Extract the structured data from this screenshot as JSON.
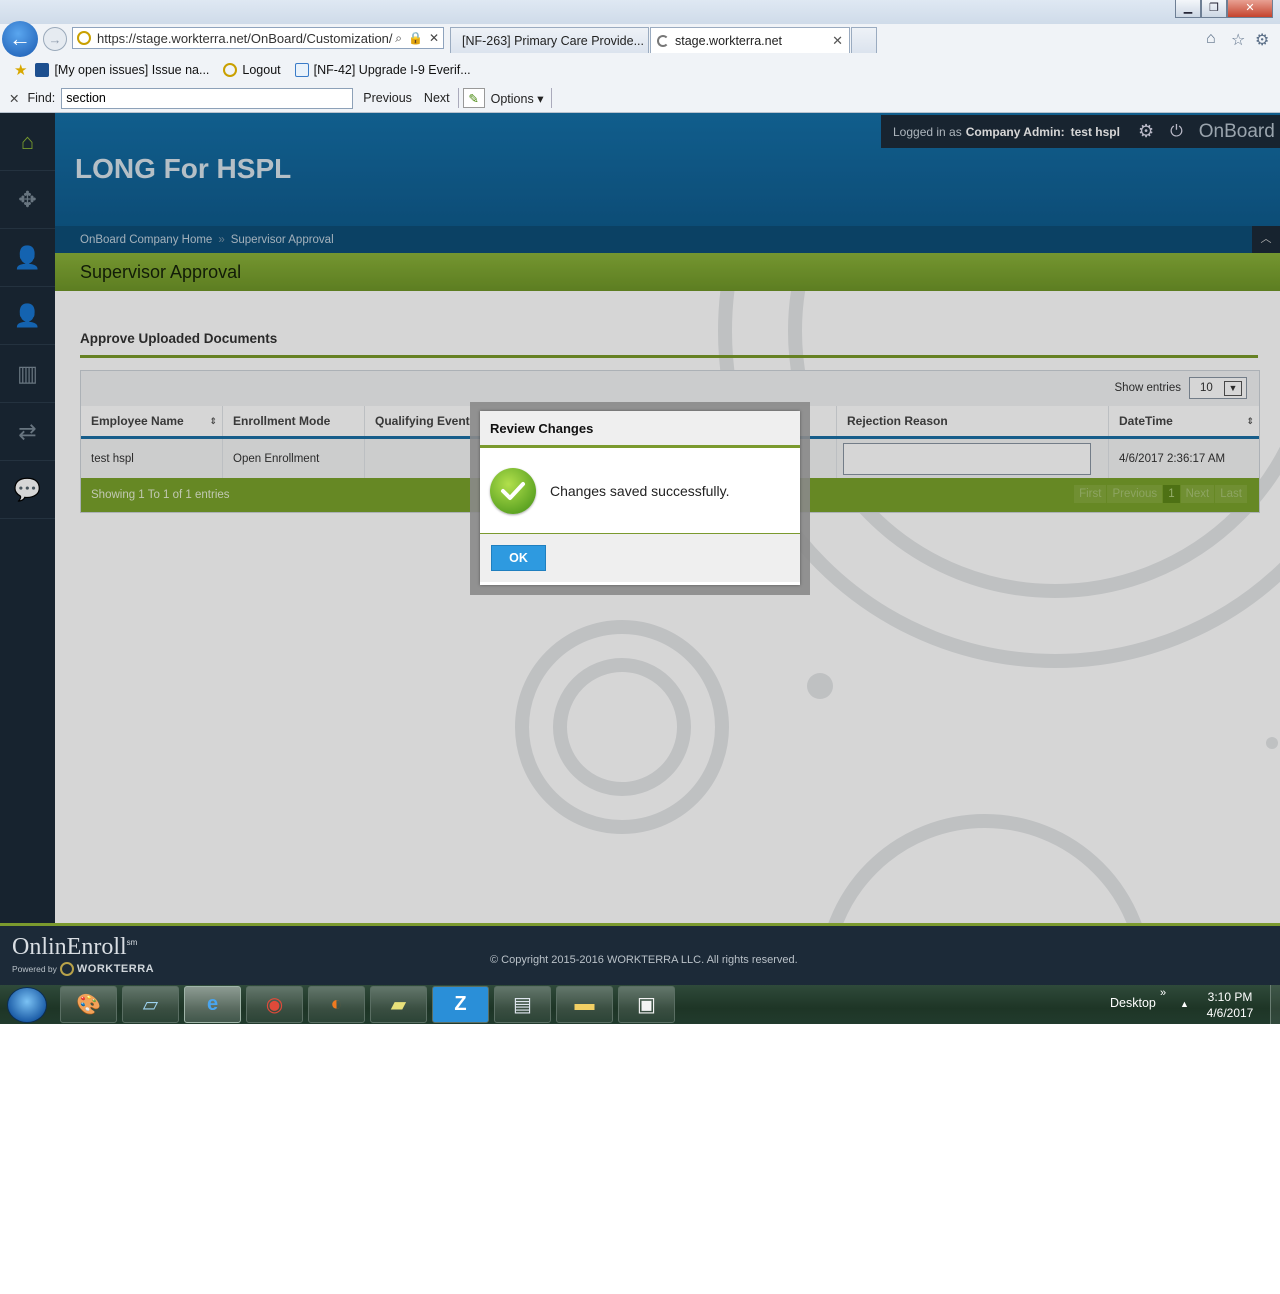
{
  "browser": {
    "address": "https://stage.workterra.net/OnBoard/Customization/",
    "address_host": "https://stage.workterra.net",
    "address_path": "/OnBoard/Customization/",
    "tabs": [
      {
        "label": "[NF-263] Primary Care Provide...",
        "active": false
      },
      {
        "label": "stage.workterra.net",
        "active": true
      }
    ],
    "favorites": [
      {
        "label": "[My open issues] Issue na...",
        "icon": "jira-icon"
      },
      {
        "label": "Logout",
        "icon": "workterra-icon"
      },
      {
        "label": "[NF-42] Upgrade I-9 Everif...",
        "icon": "ie-page-icon"
      }
    ],
    "find": {
      "label": "Find:",
      "value": "section",
      "previous": "Previous",
      "next": "Next",
      "options": "Options"
    }
  },
  "header": {
    "logged_in_prefix": "Logged in as",
    "role": "Company Admin:",
    "user": "test hspl",
    "app_name": "OnBoard",
    "company_title": "LONG For HSPL"
  },
  "breadcrumb": {
    "items": [
      "OnBoard Company Home",
      "Supervisor Approval"
    ]
  },
  "page": {
    "title": "Supervisor Approval",
    "section_title": "Approve Uploaded Documents"
  },
  "table": {
    "show_entries_label": "Show entries",
    "entries_value": "10",
    "columns": [
      "Employee Name",
      "Enrollment Mode",
      "Qualifying Event",
      "Rejection Reason",
      "DateTime"
    ],
    "rows": [
      {
        "employee_name": "test hspl",
        "enrollment_mode": "Open Enrollment",
        "qualifying_event": "",
        "rejection_reason": "",
        "datetime": "4/6/2017 2:36:17 AM"
      }
    ],
    "footer_info": "Showing 1 To 1 of 1 entries",
    "pager": {
      "first": "First",
      "previous": "Previous",
      "current": "1",
      "next": "Next",
      "last": "Last"
    }
  },
  "dialog": {
    "title": "Review Changes",
    "message": "Changes saved successfully.",
    "ok": "OK"
  },
  "footer": {
    "brand": "OnlinEnroll",
    "brand_mark": "sm",
    "powered_by": "Powered by",
    "powered_brand": "WORKTERRA",
    "copyright": "© Copyright 2015-2016 WORKTERRA LLC. All rights reserved."
  },
  "taskbar": {
    "apps": [
      "paint-icon",
      "notepad-icon",
      "internet-explorer-icon",
      "chrome-icon",
      "firefox-icon",
      "sticky-notes-icon",
      "z-app-icon",
      "network-folder-icon",
      "folder-icon",
      "document-icon"
    ],
    "desktop_label": "Desktop",
    "time": "3:10 PM",
    "date": "4/6/2017"
  },
  "colors": {
    "header_blue": "#1570a8",
    "accent_green": "#7aa22c",
    "sidebar_dark": "#1c2a38",
    "ok_blue": "#2e9ae0"
  }
}
